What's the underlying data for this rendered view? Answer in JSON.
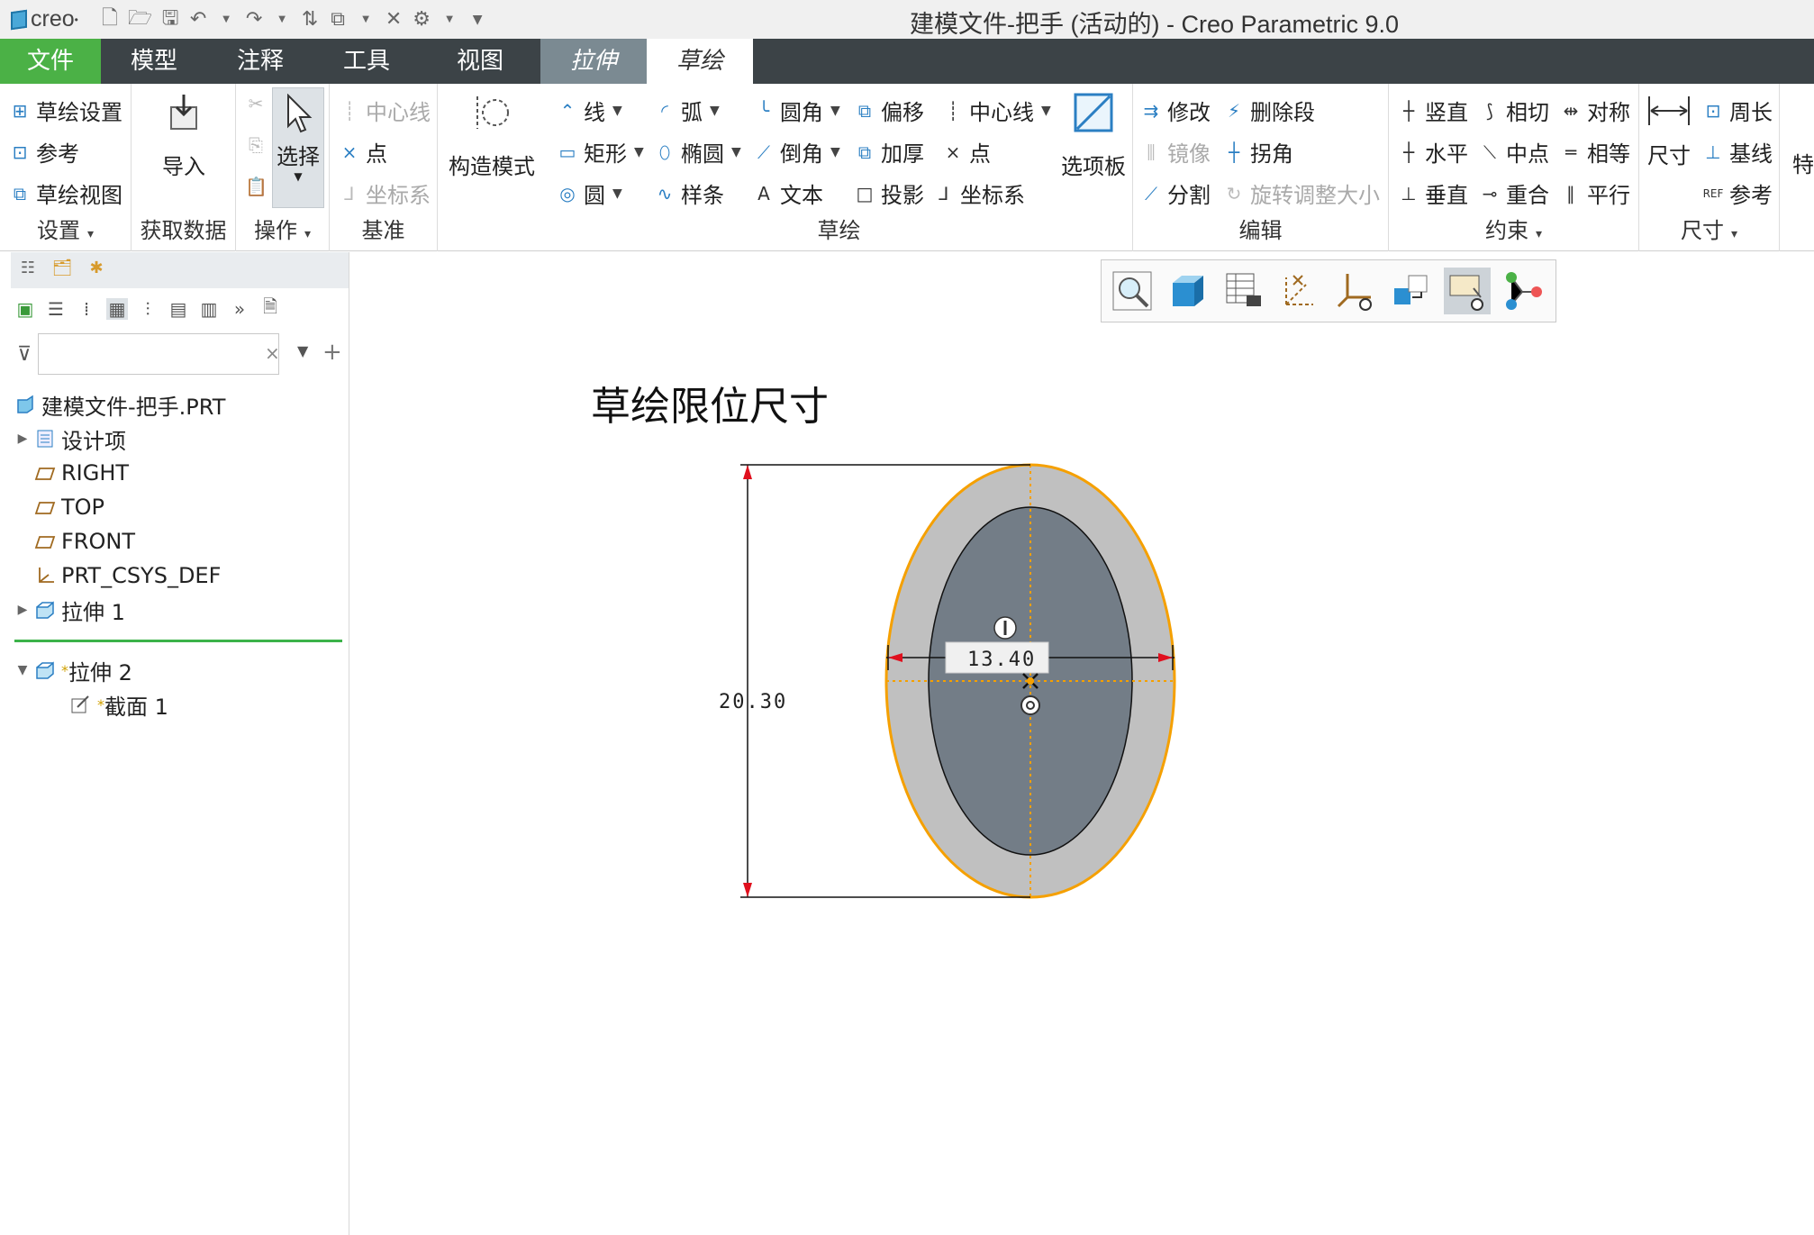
{
  "app": {
    "logo_text": "creo",
    "window_title": "建模文件-把手 (活动的) - Creo Parametric 9.0"
  },
  "tabs": [
    {
      "label": "文件"
    },
    {
      "label": "模型"
    },
    {
      "label": "注释"
    },
    {
      "label": "工具"
    },
    {
      "label": "视图"
    },
    {
      "label": "拉伸"
    },
    {
      "label": "草绘"
    }
  ],
  "ribbon": {
    "setup": {
      "label": "设置",
      "items": [
        "草绘设置",
        "参考",
        "草绘视图"
      ]
    },
    "get_data": {
      "label": "获取数据",
      "import": "导入"
    },
    "operations": {
      "label": "操作",
      "select": "选择"
    },
    "datum": {
      "label": "基准",
      "items": [
        "中心线",
        "点",
        "坐标系"
      ]
    },
    "construction": {
      "label": "构造模式"
    },
    "sketching": {
      "label": "草绘",
      "line": "线",
      "arc": "弧",
      "fillet": "圆角",
      "offset": "偏移",
      "centerline": "中心线",
      "rect": "矩形",
      "ellipse": "椭圆",
      "chamfer": "倒角",
      "thicken": "加厚",
      "point": "点",
      "circle": "圆",
      "spline": "样条",
      "text": "文本",
      "project": "投影",
      "csys": "坐标系",
      "palette": "选项板"
    },
    "editing": {
      "label": "编辑",
      "modify": "修改",
      "delete_seg": "删除段",
      "mirror": "镜像",
      "corner": "拐角",
      "divide": "分割",
      "rotate_resize": "旋转调整大小"
    },
    "constrain": {
      "label": "约束",
      "vertical": "竖直",
      "tangent": "相切",
      "symmetric": "对称",
      "horizontal": "水平",
      "midpoint": "中点",
      "equal": "相等",
      "perpendicular": "垂直",
      "coincident": "重合",
      "parallel": "平行"
    },
    "dimension": {
      "label": "尺寸",
      "dimension": "尺寸",
      "perimeter": "周长",
      "baseline": "基线",
      "reference": "参考"
    },
    "more": {
      "label": "特"
    }
  },
  "model_tree": {
    "search_value": "",
    "root": "建模文件-把手.PRT",
    "items": [
      {
        "label": "设计项"
      },
      {
        "label": "RIGHT"
      },
      {
        "label": "TOP"
      },
      {
        "label": "FRONT"
      },
      {
        "label": "PRT_CSYS_DEF"
      },
      {
        "label": "拉伸 1"
      }
    ],
    "active_feature": "拉伸 2",
    "active_child": "截面 1",
    "new_marker": "*"
  },
  "canvas": {
    "caption": "草绘限位尺寸",
    "dim_height": "20.30",
    "dim_width": "13.40"
  },
  "colors": {
    "file_tab": "#4bb146",
    "tabbar": "#3c4347",
    "outer_ring": "#c0c0c0",
    "inner_fill": "#737d87",
    "selection_orange": "#f5a000",
    "dim_arrow_red": "#e0101e"
  },
  "icons": [
    "new-icon",
    "open-icon",
    "save-icon",
    "undo-icon",
    "redo-icon",
    "regenerate-icon",
    "window-icon",
    "close-icon",
    "settings-icon"
  ]
}
